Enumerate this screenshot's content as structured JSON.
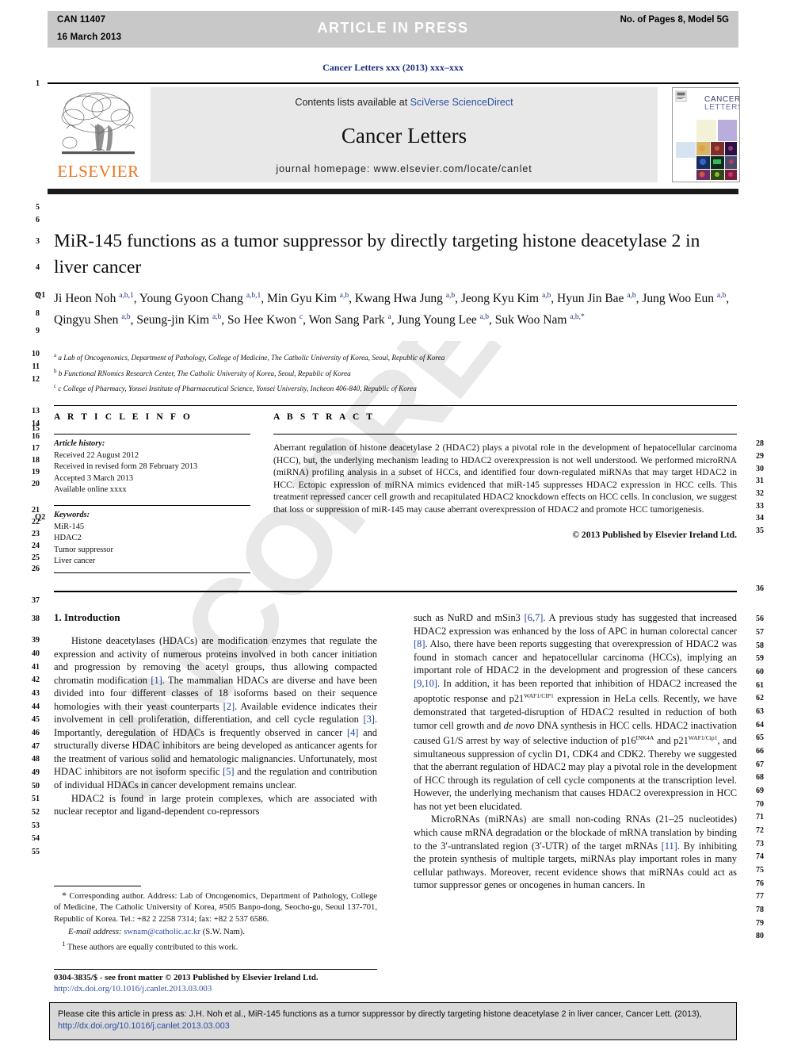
{
  "header": {
    "manuscript_id": "CAN 11407",
    "date": "16 March 2013",
    "status_banner": "ARTICLE  IN  PRESS",
    "pages_model": "No. of Pages 8, Model 5G"
  },
  "journal_ref": "Cancer Letters xxx (2013) xxx–xxx",
  "masthead": {
    "contents_prefix": "Contents lists available at ",
    "contents_link": "SciVerse ScienceDirect",
    "journal_title": "Cancer Letters",
    "homepage": "journal homepage: www.elsevier.com/locate/canlet",
    "publisher_logo_text": "ELSEVIER",
    "cover_title_line1": "CANCER",
    "cover_title_line2": "LETTERS"
  },
  "article": {
    "title": "MiR-145 functions as a tumor suppressor by directly targeting histone deacetylase 2 in liver cancer",
    "authors_html": "Ji Heon Noh <sup>a,b,1</sup>, Young Gyoon Chang <sup>a,b,1</sup>, Min Gyu Kim <sup>a,b</sup>, Kwang Hwa Jung <sup>a,b</sup>, Jeong Kyu Kim <sup>a,b</sup>, Hyun Jin Bae <sup>a,b</sup>, Jung Woo Eun <sup>a,b</sup>, Qingyu Shen <sup>a,b</sup>, Seung-jin Kim <sup>a,b</sup>, So Hee Kwon <sup>c</sup>, Won Sang Park <sup>a</sup>, Jung Young Lee <sup>a,b</sup>, Suk Woo Nam <sup>a,b,*</sup>",
    "affiliations": [
      "a Lab of Oncogenomics, Department of Pathology, College of Medicine, The Catholic University of Korea, Seoul, Republic of Korea",
      "b Functional RNomics Research Center, The Catholic University of Korea, Seoul, Republic of Korea",
      "c College of Pharmacy, Yonsei Institute of Pharmaceutical Science, Yonsei University, Incheon 406-840, Republic of Korea"
    ]
  },
  "article_info": {
    "heading": "A R T I C L E   I N F O",
    "history_label": "Article history:",
    "history": [
      "Received 22 August 2012",
      "Received in revised form 28 February 2013",
      "Accepted 3 March 2013",
      "Available online xxxx"
    ],
    "keywords_label": "Keywords:",
    "keywords": [
      "MiR-145",
      "HDAC2",
      "Tumor suppressor",
      "Liver cancer"
    ]
  },
  "abstract": {
    "heading": "A B S T R A C T",
    "text": "Aberrant regulation of histone deacetylase 2 (HDAC2) plays a pivotal role in the development of hepatocellular carcinoma (HCC), but, the underlying mechanism leading to HDAC2 overexpression is not well understood. We performed microRNA (miRNA) profiling analysis in a subset of HCCs, and identified four down-regulated miRNAs that may target HDAC2 in HCC. Ectopic expression of miRNA mimics evidenced that miR-145 suppresses HDAC2 expression in HCC cells. This treatment repressed cancer cell growth and recapitulated HDAC2 knockdown effects on HCC cells. In conclusion, we suggest that loss or suppression of miR-145 may cause aberrant overexpression of HDAC2 and promote HCC tumorigenesis.",
    "copyright": "© 2013 Published by Elsevier Ireland Ltd."
  },
  "body": {
    "section_heading": "1. Introduction",
    "left_paragraph_1_html": "Histone deacetylases (HDACs) are modification enzymes that regulate the expression and activity of numerous proteins involved in both cancer initiation and progression by removing the acetyl groups, thus allowing compacted chromatin modification <span class=\"ref\">[1]</span>. The mammalian HDACs are diverse and have been divided into four different classes of 18 isoforms based on their sequence homologies with their yeast counterparts <span class=\"ref\">[2]</span>. Available evidence indicates their involvement in cell proliferation, differentiation, and cell cycle regulation <span class=\"ref\">[3]</span>. Importantly, deregulation of HDACs is frequently observed in cancer <span class=\"ref\">[4]</span> and structurally diverse HDAC inhibitors are being developed as anticancer agents for the treatment of various solid and hematologic malignancies. Unfortunately, most HDAC inhibitors are not isoform specific <span class=\"ref\">[5]</span> and the regulation and contribution of individual HDACs in cancer development remains unclear.",
    "left_paragraph_2_html": "HDAC2 is found in large protein complexes, which are associated with nuclear receptor and ligand-dependent co-repressors",
    "right_paragraph_1_html": "such as NuRD and mSin3 <span class=\"ref\">[6,7]</span>. A previous study has suggested that increased HDAC2 expression was enhanced by the loss of APC in human colorectal cancer <span class=\"ref\">[8]</span>. Also, there have been reports suggesting that overexpression of HDAC2 was found in stomach cancer and hepatocellular carcinoma (HCCs), implying an important role of HDAC2 in the development and progression of these cancers <span class=\"ref\">[9,10]</span>. In addition, it has been reported that inhibition of HDAC2 increased the apoptotic response and p21<sup>WAF1/CIP1</sup> expression in HeLa cells. Recently, we have demonstrated that targeted-disruption of HDAC2 resulted in reduction of both tumor cell growth and <i>de novo</i> DNA synthesis in HCC cells. HDAC2 inactivation caused G1/S arrest by way of selective induction of p16<sup>INK4A</sup> and p21<sup>WAF1/Cip1</sup>, and simultaneous suppression of cyclin D1, CDK4 and CDK2. Thereby we suggested that the aberrant regulation of HDAC2 may play a pivotal role in the development of HCC through its regulation of cell cycle components at the transcription level. However, the underlying mechanism that causes HDAC2 overexpression in HCC has not yet been elucidated.",
    "right_paragraph_2_html": "MicroRNAs (miRNAs) are small non-coding RNAs (21–25 nucleotides) which cause mRNA degradation or the blockade of mRNA translation by binding to the 3′-untranslated region (3′-UTR) of the target mRNAs <span class=\"ref\">[11]</span>. By inhibiting the protein synthesis of multiple targets, miRNAs play important roles in many cellular pathways. Moreover, recent evidence shows that miRNAs could act as tumor suppressor genes or oncogenes in human cancers. In"
  },
  "footnote": {
    "corresponding_html": "<span style=\"font-size:12px\">*</span> Corresponding author. Address: Lab of Oncogenomics, Department of Pathology, College of Medicine, The Catholic University of Korea, #505 Banpo-dong, Seocho-gu, Seoul 137-701, Republic of Korea. Tel.: +82 2 2258 7314; fax: +82 2 537 6586.",
    "email_label": "E-mail address:",
    "email": "swnam@catholic.ac.kr",
    "email_suffix": "(S.W. Nam).",
    "equal_contrib_html": "<sup>1</sup> These authors are equally contributed to this work."
  },
  "issn_line": {
    "text": "0304-3835/$ - see front matter © 2013 Published by Elsevier Ireland Ltd.",
    "doi": "http://dx.doi.org/10.1016/j.canlet.2013.03.003"
  },
  "cite_box": {
    "text_prefix": "Please cite this article in press as: J.H. Noh et al., MiR-145 functions as a tumor suppressor by directly targeting histone deacetylase 2 in liver cancer, Cancer Lett. (2013), ",
    "doi": "http://dx.doi.org/10.1016/j.canlet.2013.03.003"
  },
  "watermark": "UNCORRECTED PROOF",
  "line_numbers": {
    "left": [
      "1",
      "5",
      "6",
      "3",
      "4",
      "7",
      "8",
      "9",
      "10",
      "11",
      "12",
      "13",
      "14",
      "15",
      "16",
      "17",
      "18",
      "19",
      "20",
      "21",
      "22",
      "23",
      "24",
      "25",
      "26",
      "37",
      "38",
      "39",
      "40",
      "41",
      "42",
      "43",
      "44",
      "45",
      "46",
      "47",
      "48",
      "49",
      "50",
      "51",
      "52",
      "53",
      "54",
      "55"
    ],
    "right": [
      "28",
      "29",
      "30",
      "31",
      "32",
      "33",
      "34",
      "35",
      "36",
      "56",
      "57",
      "58",
      "59",
      "60",
      "61",
      "62",
      "63",
      "64",
      "65",
      "66",
      "67",
      "68",
      "69",
      "70",
      "71",
      "72",
      "73",
      "74",
      "75",
      "76",
      "77",
      "78",
      "79",
      "80"
    ],
    "queries": [
      "Q1",
      "Q2"
    ]
  },
  "colors": {
    "banner_bg": "#c8c8c8",
    "link_blue": "#2b4ea2",
    "ref_blue": "#1f3f9c",
    "elsevier_orange": "#E87722",
    "masthead_bg": "#e8e8e8"
  }
}
